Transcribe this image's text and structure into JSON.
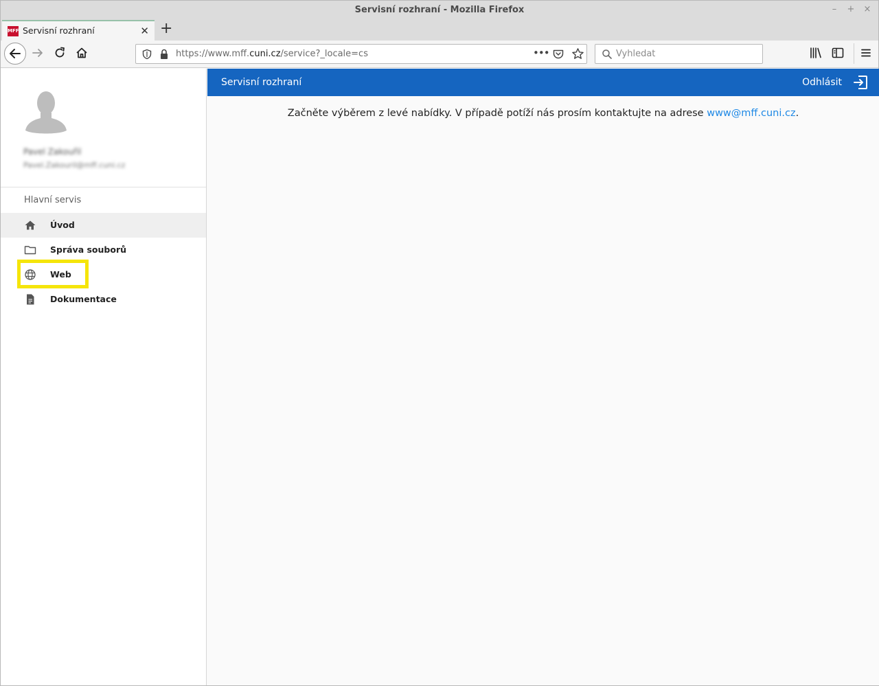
{
  "browser": {
    "window_title": "Servisní rozhraní - Mozilla Firefox",
    "tab": {
      "title": "Servisní rozhraní",
      "favicon_text": "MFF"
    },
    "url": {
      "prefix": "https://www.mff.",
      "host": "cuni.cz",
      "suffix": "/service?_locale=cs"
    },
    "search_placeholder": "Vyhledat",
    "wm_buttons": [
      "–",
      "+",
      "×"
    ]
  },
  "sidebar": {
    "user_name": "Pavel Zakouřil",
    "user_email": "Pavel.Zakouril@mff.cuni.cz",
    "section_title": "Hlavní servis",
    "items": [
      {
        "label": "Úvod",
        "icon": "home-icon"
      },
      {
        "label": "Správa souborů",
        "icon": "folder-icon"
      },
      {
        "label": "Web",
        "icon": "globe-icon"
      },
      {
        "label": "Dokumentace",
        "icon": "document-icon"
      }
    ]
  },
  "appbar": {
    "title": "Servisní rozhraní",
    "logout_label": "Odhlásit"
  },
  "main": {
    "message_prefix": "Začněte výběrem z levé nabídky. V případě potíží nás prosím kontaktujte na adrese ",
    "contact_email": "www@mff.cuni.cz",
    "message_suffix": "."
  },
  "colors": {
    "accent": "#1565c0",
    "link": "#1e88e5",
    "highlight": "#f5e50a"
  }
}
